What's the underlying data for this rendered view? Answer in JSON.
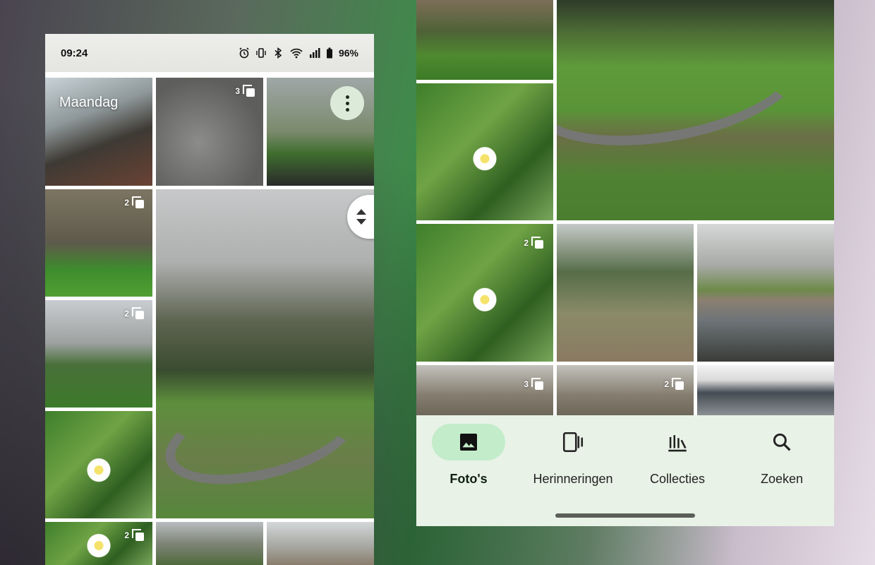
{
  "left_phone": {
    "status": {
      "time": "09:24",
      "battery": "96%",
      "icons": [
        "alarm-icon",
        "vibrate-icon",
        "bluetooth-icon",
        "wifi-icon",
        "signal-icon",
        "battery-icon"
      ]
    },
    "day_label": "Maandag",
    "bursts": {
      "path": "3",
      "park1": "2",
      "path2": "2",
      "daisy_bottom": "2"
    }
  },
  "right_phone": {
    "bursts": {
      "daisy": "2",
      "bare1": "3",
      "bare2": "2"
    },
    "nav": {
      "items": [
        {
          "label": "Foto's",
          "icon": "photo-icon",
          "active": true
        },
        {
          "label": "Herinneringen",
          "icon": "memories-icon",
          "active": false
        },
        {
          "label": "Collecties",
          "icon": "collections-icon",
          "active": false
        },
        {
          "label": "Zoeken",
          "icon": "search-icon",
          "active": false
        }
      ]
    }
  },
  "colors": {
    "nav_bg": "#e8f2e6",
    "nav_active": "#c3ecca",
    "menu_btn": "#dcebd9"
  }
}
